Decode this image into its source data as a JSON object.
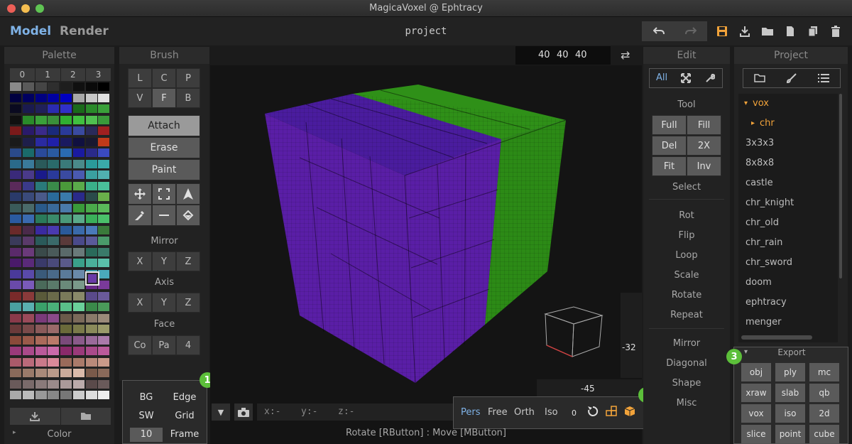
{
  "window": {
    "title": "MagicaVoxel @ Ephtracy"
  },
  "topbar": {
    "model_tab": "Model",
    "render_tab": "Render",
    "project": "project"
  },
  "palette": {
    "title": "Palette",
    "tabs": [
      "0",
      "1",
      "2",
      "3"
    ],
    "color_label": "Color",
    "colors": [
      [
        "#8a8a8a",
        "#5a5a5a",
        "#454545",
        "#2e2e2e",
        "#1e1e1e",
        "#101010",
        "#0a0a0a",
        "#000000"
      ],
      [
        "#000040",
        "#000060",
        "#000080",
        "#0000a0",
        "#0000c0",
        "#a8a8a8",
        "#c8c8c8",
        "#e0e0e0"
      ],
      [
        "#0a0a20",
        "#1a1a50",
        "#20205a",
        "#2b2bb0",
        "#3030c8",
        "#1a6a1a",
        "#2a8a2a",
        "#3aa03a"
      ],
      [
        "#101010",
        "#2a8a2a",
        "#3aa03a",
        "#3a903a",
        "#30b030",
        "#40c040",
        "#50c050",
        "#3a9a3a"
      ],
      [
        "#7a1a1a",
        "#2a1a6a",
        "#3a2a8a",
        "#1a2a7a",
        "#2a3a9a",
        "#3a4aa0",
        "#2a2a5a",
        "#a02020"
      ],
      [
        "#1a1a1a",
        "#1e1e4a",
        "#2a2aa0",
        "#2020a8",
        "#1a1a60",
        "#101040",
        "#181830",
        "#c03a1a"
      ],
      [
        "#2a4a8a",
        "#1a6a6a",
        "#2a4a9a",
        "#2a5aa0",
        "#2a6ab0",
        "#1a1aa0",
        "#2a2a8a",
        "#3a4ac0"
      ],
      [
        "#2a6a8a",
        "#3a7a9a",
        "#2a5a5a",
        "#2a6a6a",
        "#3a7a7a",
        "#4a8a8a",
        "#2a9a9a",
        "#3aaaaa"
      ],
      [
        "#3a2a7a",
        "#4a3a8a",
        "#1a1a8a",
        "#2a3a9a",
        "#3a4aa0",
        "#4a5ab0",
        "#3aa0a0",
        "#50b0b0"
      ],
      [
        "#5a2a5a",
        "#3a3a8a",
        "#2a7a7a",
        "#3a8a4a",
        "#4a9a3a",
        "#5aaa4a",
        "#3ab08a",
        "#4ac09a"
      ],
      [
        "#2a3a6a",
        "#3a4a7a",
        "#4a5a8a",
        "#2a6a9a",
        "#3a7aaa",
        "#2a2a8a",
        "#2a4a4a",
        "#6ab04a"
      ],
      [
        "#3a5a5a",
        "#4a6a6a",
        "#2a5a8a",
        "#3a6a9a",
        "#4a7aaa",
        "#3a9a3a",
        "#4aaa4a",
        "#5aba5a"
      ],
      [
        "#2a5aa0",
        "#3a6ab0",
        "#2a7a5a",
        "#3a8a6a",
        "#4a9a7a",
        "#5aaa8a",
        "#3ab05a",
        "#4ac06a"
      ],
      [
        "#6a2a2a",
        "#4a2a4a",
        "#3a2aa0",
        "#4a3ab0",
        "#2a5a9a",
        "#3a6aaa",
        "#4a7aba",
        "#3a7a3a"
      ],
      [
        "#3a3a5a",
        "#5a3a6a",
        "#2a5a5a",
        "#3a6a6a",
        "#5a3a3a",
        "#4a4a8a",
        "#5a5a9a",
        "#4a9a6a"
      ],
      [
        "#5a2a6a",
        "#6a3a7a",
        "#3a4a4a",
        "#4a5a5a",
        "#5a6a6a",
        "#6a7a7a",
        "#2a6a5a",
        "#3a7a6a"
      ],
      [
        "#4a1a6a",
        "#5a2a7a",
        "#3a3a6a",
        "#4a4a7a",
        "#5a5a8a",
        "#3aa08a",
        "#4ab09a",
        "#5ac0aa"
      ],
      [
        "#4a3a9a",
        "#5a4aaa",
        "#3a5a7a",
        "#4a6a8a",
        "#5a7a9a",
        "#6a8aaa",
        "#3a9aaa",
        "#4aaaba"
      ],
      [
        "#6a4aaa",
        "#7a5aba",
        "#4a6a5a",
        "#5a7a6a",
        "#6a8a7a",
        "#7a9a8a",
        "#6a2a8a",
        "#7a3a9a"
      ],
      [
        "#7a2a2a",
        "#8a3a3a",
        "#5a5a3a",
        "#6a6a4a",
        "#7a7a5a",
        "#8a8a6a",
        "#5a4a8a",
        "#6a5a9a"
      ],
      [
        "#4aa0a0",
        "#5ab0b0",
        "#3aa06a",
        "#4ab07a",
        "#5ac08a",
        "#6ad09a",
        "#3a8a4a",
        "#4a9a5a"
      ],
      [
        "#8a3a4a",
        "#9a4a5a",
        "#7a3a7a",
        "#8a4a8a",
        "#6a5a4a",
        "#7a6a5a",
        "#8a7a6a",
        "#9a8a7a"
      ],
      [
        "#6a3a3a",
        "#7a4a4a",
        "#8a5a5a",
        "#9a6a6a",
        "#6a6a3a",
        "#7a7a4a",
        "#8a8a5a",
        "#9a9a6a"
      ],
      [
        "#8a4a3a",
        "#9a5a4a",
        "#aa6a5a",
        "#ba7a6a",
        "#7a4a7a",
        "#8a5a8a",
        "#9a6a9a",
        "#aa7aaa"
      ],
      [
        "#9a3a7a",
        "#aa4a8a",
        "#ba5a9a",
        "#ca6aaa",
        "#8a2a6a",
        "#9a3a7a",
        "#aa4a8a",
        "#ba5a9a"
      ],
      [
        "#aa5a6a",
        "#ba6a7a",
        "#ca7a8a",
        "#da8a9a",
        "#9a6a5a",
        "#aa7a6a",
        "#ba8a7a",
        "#ca9a8a"
      ],
      [
        "#8a6a5a",
        "#9a7a6a",
        "#aa8a7a",
        "#ba9a8a",
        "#caaa9a",
        "#dabaaa",
        "#7a5a4a",
        "#8a6a5a"
      ],
      [
        "#6a5a5a",
        "#7a6a6a",
        "#8a7a7a",
        "#9a8a8a",
        "#aa9a9a",
        "#bbaaaa",
        "#5a4a4a",
        "#6a5a5a"
      ],
      [
        "#aaaaaa",
        "#bbbbbb",
        "#999999",
        "#888888",
        "#777777",
        "#cccccc",
        "#dddddd",
        "#eeeeee"
      ]
    ],
    "selected_color": "#6a3aa8"
  },
  "brush": {
    "title": "Brush",
    "types": [
      "L",
      "C",
      "P",
      "V",
      "F",
      "B"
    ],
    "modes": [
      "Attach",
      "Erase",
      "Paint"
    ],
    "mirror_label": "Mirror",
    "mirror": [
      "X",
      "Y",
      "Z"
    ],
    "axis_label": "Axis",
    "axis": [
      "X",
      "Y",
      "Z"
    ],
    "face_label": "Face",
    "face": [
      "Co",
      "Pa",
      "4"
    ]
  },
  "dims": {
    "x": "40",
    "y": "40",
    "z": "40"
  },
  "edit": {
    "title": "Edit",
    "tabs": [
      "All"
    ],
    "tool_label": "Tool",
    "tools": [
      "Full",
      "Fill",
      "Del",
      "2X",
      "Fit",
      "Inv"
    ],
    "select_label": "Select",
    "ops": [
      "Rot",
      "Flip",
      "Loop",
      "Scale",
      "Rotate",
      "Repeat"
    ],
    "extra": [
      "Mirror",
      "Diagonal",
      "Shape",
      "Misc"
    ]
  },
  "project": {
    "title": "Project",
    "items": [
      "vox",
      "chr",
      "3x3x3",
      "8x8x8",
      "castle",
      "chr_knight",
      "chr_old",
      "chr_rain",
      "chr_sword",
      "doom",
      "ephtracy",
      "menger"
    ],
    "export_label": "Export",
    "export": [
      "obj",
      "ply",
      "mc",
      "xraw",
      "slab",
      "qb",
      "vox",
      "iso",
      "2d",
      "slice",
      "point",
      "cube"
    ]
  },
  "view_options": {
    "items": [
      "BG",
      "Edge",
      "SW",
      "Grid",
      "10",
      "Frame"
    ]
  },
  "camera": {
    "modes": [
      "Pers",
      "Free",
      "Orth",
      "Iso"
    ],
    "value": "0"
  },
  "coords": {
    "x": "x:-",
    "y": "y:-",
    "z": "z:-"
  },
  "status": {
    "hint": "Rotate [RButton] : Move [MButton]"
  },
  "viewport": {
    "angle_pitch": "-32",
    "angle_yaw": "-45"
  },
  "badges": [
    "1",
    "2",
    "3"
  ],
  "colors": {
    "purple": "#5a1ea6",
    "green": "#2c8a16",
    "accent": "#f2a33a",
    "badge": "#5cbf3a"
  }
}
